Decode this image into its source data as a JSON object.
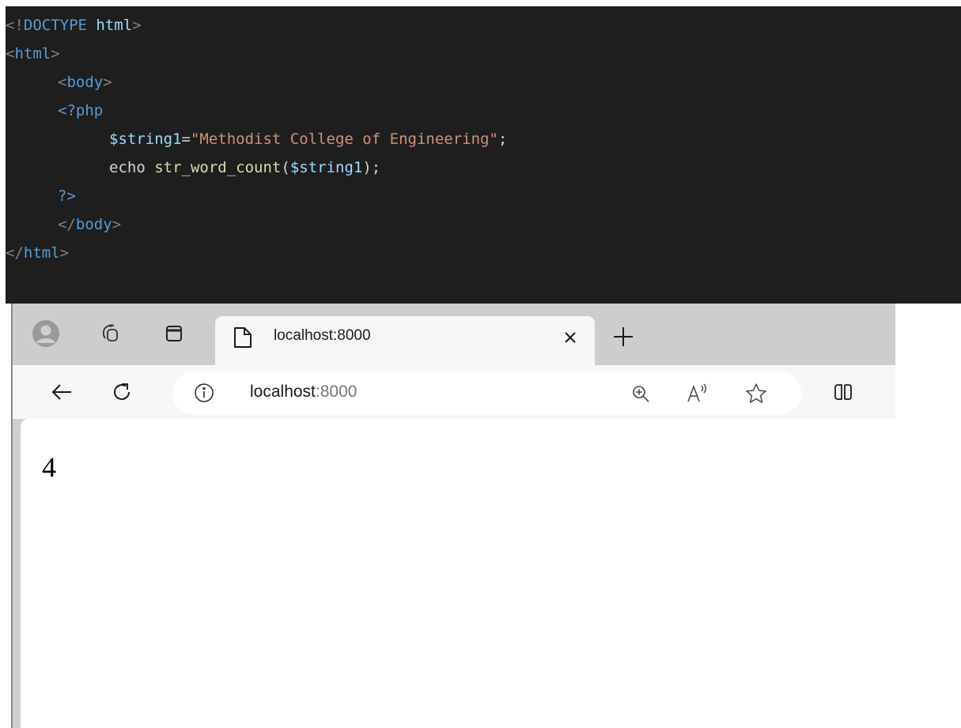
{
  "editor": {
    "lines": [
      {
        "indent": 0,
        "tokens": [
          {
            "t": "<!",
            "c": "punc"
          },
          {
            "t": "DOCTYPE",
            "c": "tag"
          },
          {
            "t": " ",
            "c": "plain"
          },
          {
            "t": "html",
            "c": "attr"
          },
          {
            "t": ">",
            "c": "punc"
          }
        ]
      },
      {
        "indent": 0,
        "tokens": [
          {
            "t": "<",
            "c": "punc"
          },
          {
            "t": "html",
            "c": "tag"
          },
          {
            "t": ">",
            "c": "punc"
          }
        ]
      },
      {
        "indent": 1,
        "tokens": [
          {
            "t": "<",
            "c": "punc"
          },
          {
            "t": "body",
            "c": "tag"
          },
          {
            "t": ">",
            "c": "punc"
          }
        ]
      },
      {
        "indent": 1,
        "tokens": [
          {
            "t": "<?php",
            "c": "tag"
          }
        ]
      },
      {
        "indent": 2,
        "tokens": [
          {
            "t": "$string1",
            "c": "var"
          },
          {
            "t": "=",
            "c": "plain"
          },
          {
            "t": "\"Methodist College of Engineering\"",
            "c": "str"
          },
          {
            "t": ";",
            "c": "plain"
          }
        ]
      },
      {
        "indent": 2,
        "tokens": [
          {
            "t": "echo ",
            "c": "plain"
          },
          {
            "t": "str_word_count",
            "c": "fn"
          },
          {
            "t": "(",
            "c": "plain"
          },
          {
            "t": "$string1",
            "c": "var"
          },
          {
            "t": ");",
            "c": "plain"
          }
        ]
      },
      {
        "indent": 1,
        "tokens": [
          {
            "t": "?>",
            "c": "tag"
          }
        ]
      },
      {
        "indent": 1,
        "tokens": [
          {
            "t": "</",
            "c": "punc"
          },
          {
            "t": "body",
            "c": "tag"
          },
          {
            "t": ">",
            "c": "punc"
          }
        ]
      },
      {
        "indent": 0,
        "tokens": [
          {
            "t": "</",
            "c": "punc"
          },
          {
            "t": "html",
            "c": "tag"
          },
          {
            "t": ">",
            "c": "punc"
          }
        ]
      }
    ],
    "colors": {
      "background": "#1e1e1e",
      "tag": "#569cd6",
      "string": "#ce9178",
      "variable": "#9cdcfe"
    }
  },
  "browser": {
    "tab": {
      "title": "localhost:8000"
    },
    "address": {
      "host": "localhost",
      "port": ":8000"
    },
    "icons": {
      "profile": "profile-avatar-icon",
      "collections": "collections-icon",
      "workspace": "tab-actions-icon",
      "page": "page-icon",
      "close": "close-icon",
      "new_tab": "plus-icon",
      "back": "back-arrow-icon",
      "refresh": "refresh-icon",
      "info": "info-icon",
      "zoom": "zoom-in-icon",
      "read_aloud": "read-aloud-icon",
      "favorite": "star-icon",
      "split": "split-screen-icon"
    }
  },
  "page": {
    "output": "4"
  }
}
